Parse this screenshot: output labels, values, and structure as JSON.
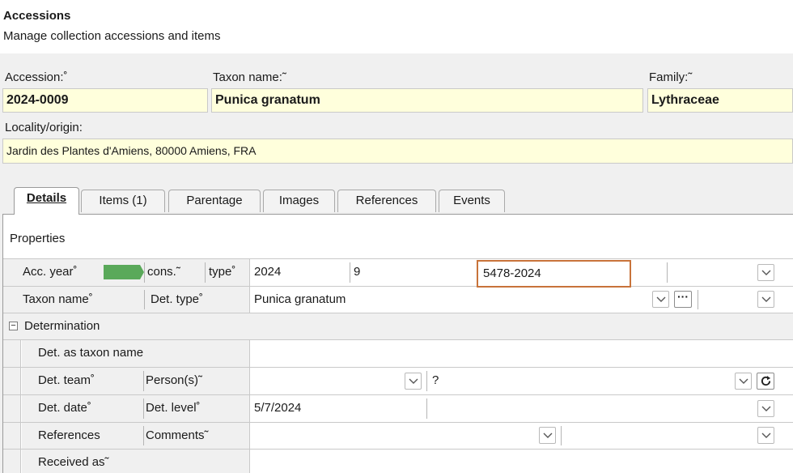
{
  "header": {
    "title": "Accessions",
    "subtitle": "Manage collection accessions and items"
  },
  "form": {
    "accession_label": "Accession:˚",
    "accession_value": "2024-0009",
    "taxon_label": "Taxon name:˜",
    "taxon_value": "Punica granatum",
    "family_label": "Family:˜",
    "family_value": "Lythraceae",
    "locality_label": "Locality/origin:",
    "locality_value": "Jardin des Plantes d'Amiens, 80000 Amiens, FRA"
  },
  "tabs": [
    {
      "label": "Details",
      "active": true
    },
    {
      "label": "Items (1)",
      "active": false
    },
    {
      "label": "Parentage",
      "active": false
    },
    {
      "label": "Images",
      "active": false
    },
    {
      "label": "References",
      "active": false
    },
    {
      "label": "Events",
      "active": false
    }
  ],
  "properties": {
    "header": "Properties",
    "acc_year_label": "Acc. year˚",
    "cons_label": "cons.˜",
    "type_label": "type˚",
    "acc_year_value": "2024",
    "cons_value": "9",
    "type_value": "5478-2024",
    "taxon_name_label": "Taxon name˚",
    "det_type_label": "Det. type˚",
    "taxon_name_value": "Punica granatum",
    "determination_group": "Determination",
    "det_as_taxon_label": "Det. as taxon name",
    "det_team_label": "Det. team˚",
    "persons_label": "Person(s)˜",
    "persons_value": "?",
    "det_date_label": "Det. date˚",
    "det_level_label": "Det. level˚",
    "det_date_value": "5/7/2024",
    "references_label": "References",
    "comments_label": "Comments˜",
    "received_as_label": "Received as˜"
  },
  "colors": {
    "highlight_field": "#ffffdc",
    "focus_border": "#c8733a",
    "status_green": "#5aa95a"
  },
  "icons": [
    "chevron-down-icon",
    "ellipsis-icon",
    "refresh-icon",
    "collapse-icon"
  ]
}
